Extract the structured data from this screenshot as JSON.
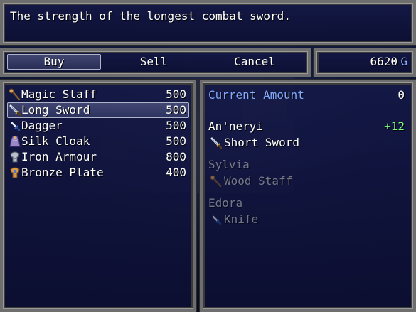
{
  "help": {
    "text": "The strength of the longest combat sword."
  },
  "commands": {
    "buy": "Buy",
    "sell": "Sell",
    "cancel": "Cancel"
  },
  "gold": {
    "amount": "6620",
    "unit": "G"
  },
  "items": [
    {
      "name": "Magic Staff",
      "price": "500",
      "icon": "staff-icon"
    },
    {
      "name": "Long Sword",
      "price": "500",
      "icon": "sword-icon"
    },
    {
      "name": "Dagger",
      "price": "500",
      "icon": "dagger-icon"
    },
    {
      "name": "Silk Cloak",
      "price": "500",
      "icon": "cloak-icon"
    },
    {
      "name": "Iron Armour",
      "price": "800",
      "icon": "armor-icon"
    },
    {
      "name": "Bronze Plate",
      "price": "400",
      "icon": "plate-armor-icon"
    }
  ],
  "selected_index": 1,
  "status": {
    "current_amount_label": "Current Amount",
    "current_amount_value": "0",
    "actors": [
      {
        "name": "An'neryi",
        "change": "+12",
        "equip": "Short Sword",
        "icon": "sword-icon",
        "can_equip": true
      },
      {
        "name": "Sylvia",
        "change": "",
        "equip": "Wood Staff",
        "icon": "staff-icon",
        "can_equip": false
      },
      {
        "name": "Edora",
        "change": "",
        "equip": "Knife",
        "icon": "knife-icon",
        "can_equip": false
      }
    ]
  },
  "colors": {
    "system": "#84aaff",
    "power_up": "#80ff80",
    "window_bg": "#141846"
  }
}
